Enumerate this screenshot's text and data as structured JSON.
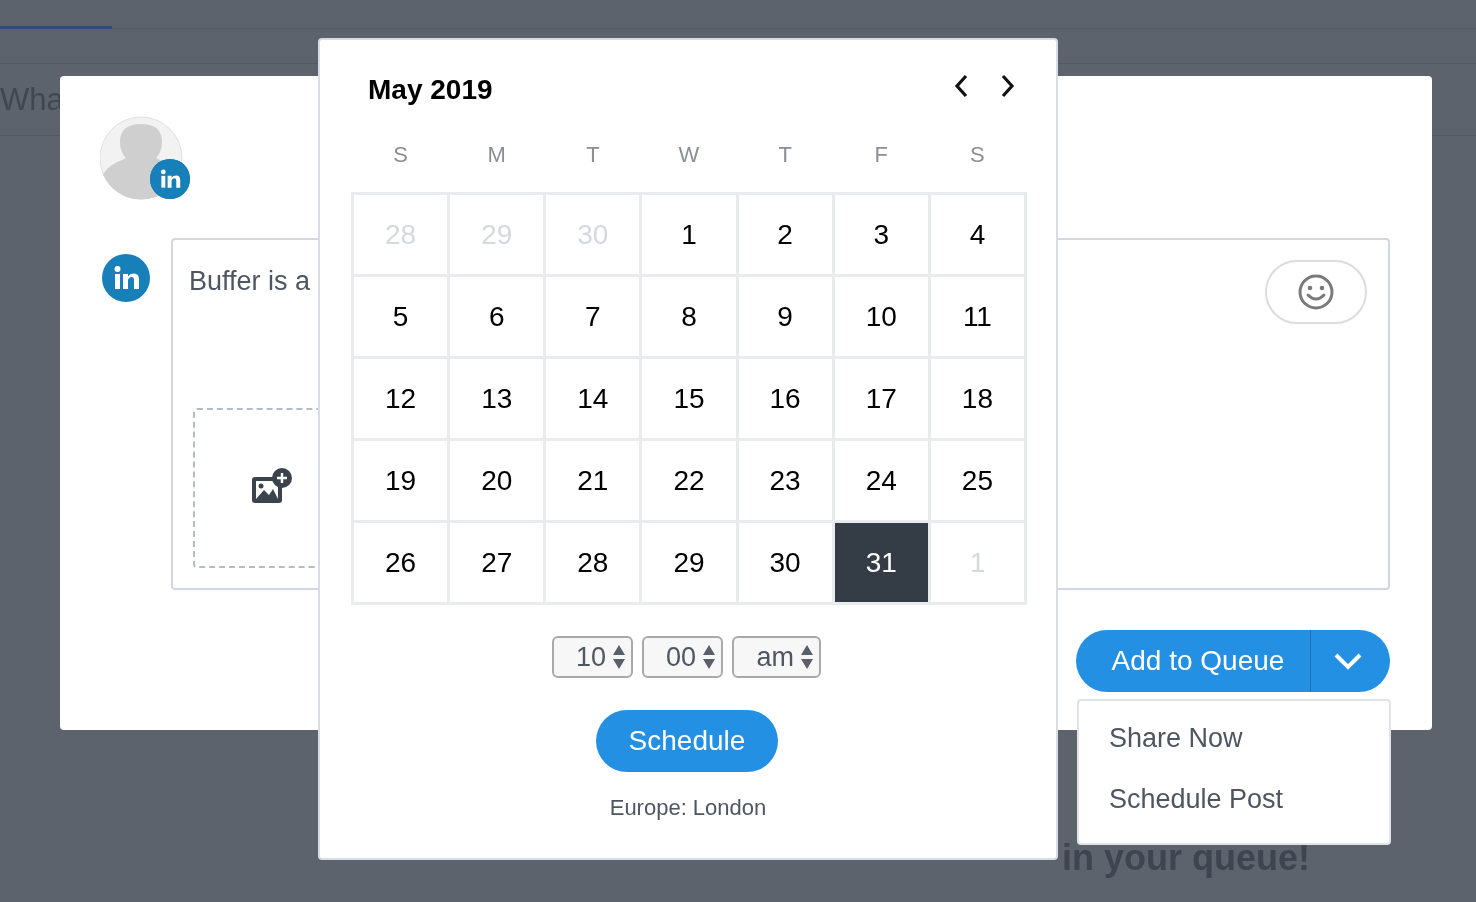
{
  "background": {
    "composer_placeholder": "Wha",
    "empty_message": "in your queue!"
  },
  "composer": {
    "text": "Buffer is a",
    "primary_button": "Add to Queue"
  },
  "dropdown_menu": {
    "items": [
      "Share Now",
      "Schedule Post"
    ]
  },
  "calendar": {
    "title": "May 2019",
    "weekdays": [
      "S",
      "M",
      "T",
      "W",
      "T",
      "F",
      "S"
    ],
    "days": [
      {
        "label": "28",
        "muted": true,
        "selected": false
      },
      {
        "label": "29",
        "muted": true,
        "selected": false
      },
      {
        "label": "30",
        "muted": true,
        "selected": false
      },
      {
        "label": "1",
        "muted": false,
        "selected": false
      },
      {
        "label": "2",
        "muted": false,
        "selected": false
      },
      {
        "label": "3",
        "muted": false,
        "selected": false
      },
      {
        "label": "4",
        "muted": false,
        "selected": false
      },
      {
        "label": "5",
        "muted": false,
        "selected": false
      },
      {
        "label": "6",
        "muted": false,
        "selected": false
      },
      {
        "label": "7",
        "muted": false,
        "selected": false
      },
      {
        "label": "8",
        "muted": false,
        "selected": false
      },
      {
        "label": "9",
        "muted": false,
        "selected": false
      },
      {
        "label": "10",
        "muted": false,
        "selected": false
      },
      {
        "label": "11",
        "muted": false,
        "selected": false
      },
      {
        "label": "12",
        "muted": false,
        "selected": false
      },
      {
        "label": "13",
        "muted": false,
        "selected": false
      },
      {
        "label": "14",
        "muted": false,
        "selected": false
      },
      {
        "label": "15",
        "muted": false,
        "selected": false
      },
      {
        "label": "16",
        "muted": false,
        "selected": false
      },
      {
        "label": "17",
        "muted": false,
        "selected": false
      },
      {
        "label": "18",
        "muted": false,
        "selected": false
      },
      {
        "label": "19",
        "muted": false,
        "selected": false
      },
      {
        "label": "20",
        "muted": false,
        "selected": false
      },
      {
        "label": "21",
        "muted": false,
        "selected": false
      },
      {
        "label": "22",
        "muted": false,
        "selected": false
      },
      {
        "label": "23",
        "muted": false,
        "selected": false
      },
      {
        "label": "24",
        "muted": false,
        "selected": false
      },
      {
        "label": "25",
        "muted": false,
        "selected": false
      },
      {
        "label": "26",
        "muted": false,
        "selected": false
      },
      {
        "label": "27",
        "muted": false,
        "selected": false
      },
      {
        "label": "28",
        "muted": false,
        "selected": false
      },
      {
        "label": "29",
        "muted": false,
        "selected": false
      },
      {
        "label": "30",
        "muted": false,
        "selected": false
      },
      {
        "label": "31",
        "muted": false,
        "selected": true
      },
      {
        "label": "1",
        "muted": true,
        "selected": false
      }
    ],
    "time": {
      "hour": "10",
      "minute": "00",
      "period": "am"
    },
    "schedule_button": "Schedule",
    "timezone": "Europe: London"
  }
}
